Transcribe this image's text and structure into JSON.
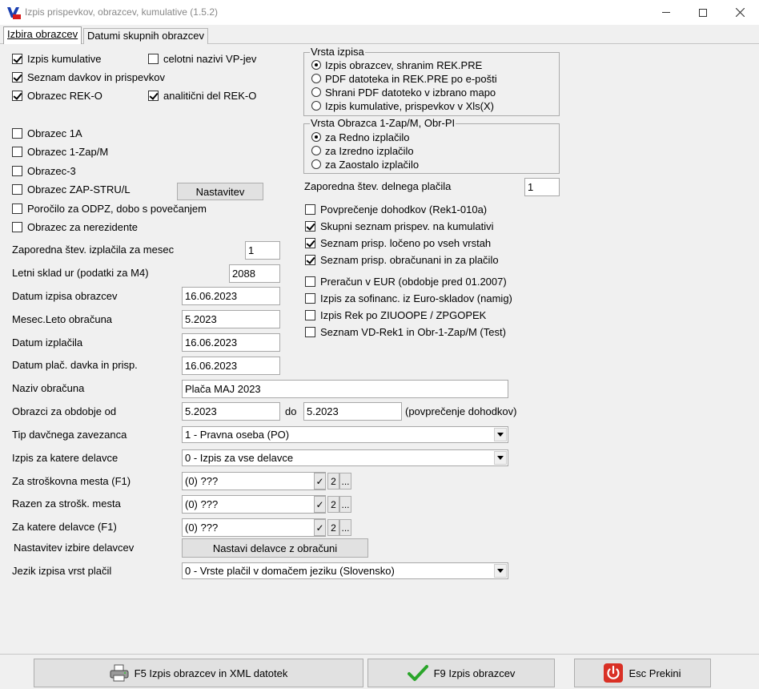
{
  "window": {
    "title": "Izpis prispevkov, obrazcev, kumulative  (1.5.2)"
  },
  "tabs": [
    {
      "label": "Izbira obrazcev"
    },
    {
      "label": "Datumi skupnih obrazcev"
    }
  ],
  "left_checks": [
    {
      "label": "Izpis kumulative",
      "checked": true
    },
    {
      "label": "celotni nazivi VP-jev",
      "checked": false
    },
    {
      "label": "Seznam davkov in prispevkov",
      "checked": true
    },
    {
      "label": "Obrazec REK-O",
      "checked": true
    },
    {
      "label": "analitični del REK-O",
      "checked": true
    },
    {
      "label": "Obrazec 1A",
      "checked": false
    },
    {
      "label": "Obrazec 1-Zap/M",
      "checked": false
    },
    {
      "label": "Obrazec-3",
      "checked": false
    },
    {
      "label": "Obrazec ZAP-STRU/L",
      "checked": false
    },
    {
      "label": "Poročilo za ODPZ, dobo s povečanjem",
      "checked": false
    },
    {
      "label": "Obrazec za nerezidente",
      "checked": false
    }
  ],
  "nastavitev_button": "Nastavitev",
  "vrsta_izpisa": {
    "title": "Vrsta izpisa",
    "options": [
      {
        "label": "Izpis obrazcev, shranim REK.PRE",
        "selected": true
      },
      {
        "label": "PDF datoteka in REK.PRE po e-pošti",
        "selected": false
      },
      {
        "label": "Shrani PDF datoteko v izbrano mapo",
        "selected": false
      },
      {
        "label": "Izpis kumulative, prispevkov v Xls(X)",
        "selected": false
      }
    ]
  },
  "vrsta_obrazca": {
    "title": "Vrsta  Obrazca 1-Zap/M, Obr-PI",
    "options": [
      {
        "label": "za Redno izplačilo",
        "selected": true
      },
      {
        "label": "za Izredno izplačilo",
        "selected": false
      },
      {
        "label": "za Zaostalo izplačilo",
        "selected": false
      }
    ]
  },
  "zaporedna_delnega": {
    "label": "Zaporedna štev. delnega plačila",
    "value": "1"
  },
  "right_checks": [
    {
      "label": "Povprečenje dohodkov (Rek1-010a)",
      "checked": false
    },
    {
      "label": "Skupni seznam prispev. na kumulativi",
      "checked": true
    },
    {
      "label": "Seznam prisp. ločeno po vseh vrstah",
      "checked": true
    },
    {
      "label": "Seznam prisp. obračunani in za plačilo",
      "checked": true
    },
    {
      "label": "Preračun v EUR (obdobje pred 01.2007)",
      "checked": false
    },
    {
      "label": "Izpis za sofinanc. iz Euro-skladov (namig)",
      "checked": false
    },
    {
      "label": "Izpis Rek po ZIUOOPE / ZPGOPEK",
      "checked": false
    },
    {
      "label": "Seznam VD-Rek1 in Obr-1-Zap/M (Test)",
      "checked": false
    }
  ],
  "fields": {
    "zaporedna_mesec": {
      "label": "Zaporedna štev. izplačila za mesec",
      "value": "1"
    },
    "letni_sklad": {
      "label": "Letni sklad ur (podatki za M4)",
      "value": "2088"
    },
    "datum_izpisa": {
      "label": "Datum izpisa obrazcev",
      "value": "16.06.2023"
    },
    "mesec_leto": {
      "label": "Mesec.Leto obračuna",
      "value": "5.2023"
    },
    "datum_izplacila": {
      "label": "Datum izplačila",
      "value": "16.06.2023"
    },
    "datum_placila_davka": {
      "label": "Datum plač. davka in prisp.",
      "value": "16.06.2023"
    },
    "naziv": {
      "label": "Naziv obračuna",
      "value": "Plača MAJ 2023"
    },
    "obdobje": {
      "label": "Obrazci za obdobje od",
      "from": "5.2023",
      "do_label": "do",
      "to": "5.2023",
      "suffix": "(povprečenje dohodkov)"
    },
    "tip_zavezanca": {
      "label": "Tip davčnega zavezanca",
      "value": "1 - Pravna oseba (PO)"
    },
    "izpis_delavce": {
      "label": "Izpis za katere delavce",
      "value": "0 - Izpis za vse delavce"
    },
    "stroskovna_mesta": {
      "label": "Za stroškovna mesta (F1)",
      "value": "(0) ???"
    },
    "razen_strosk": {
      "label": "Razen za strošk. mesta",
      "value": "(0) ???"
    },
    "katere_delavce": {
      "label": "Za katere delavce (F1)",
      "value": "(0) ???"
    },
    "nastavitev_izbire": {
      "label": "Nastavitev izbire delavcev",
      "button": "Nastavi delavce z obračuni"
    },
    "jezik": {
      "label": "Jezik izpisa vrst plačil",
      "value": "0 - Vrste plačil v domačem jeziku (Slovensko)"
    }
  },
  "picker_buttons": {
    "check": "✓",
    "two": "2",
    "dots": "..."
  },
  "bottom_buttons": {
    "f5": "F5  Izpis obrazcev in XML datotek",
    "f9": "F9  Izpis obrazcev",
    "esc": "Esc  Prekini"
  },
  "colors": {
    "accent_green": "#2aa52a",
    "stop_red": "#d93025"
  }
}
